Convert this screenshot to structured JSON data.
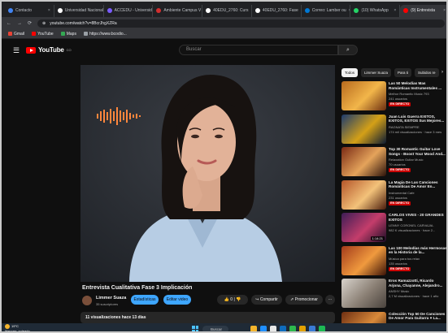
{
  "browser": {
    "tabs": [
      {
        "label": "Contacto",
        "color": "#4285f4",
        "active": false
      },
      {
        "label": "Universidad Nacional",
        "color": "#ffffff",
        "active": false
      },
      {
        "label": "ACCEDU - Universida",
        "color": "#7a5cff",
        "active": false
      },
      {
        "label": "Ambiente Campus V",
        "color": "#d32f2f",
        "active": false
      },
      {
        "label": "40EDU_2760: Curs",
        "color": "#ffffff",
        "active": false
      },
      {
        "label": "40EDU_2760: Fase",
        "color": "#ffffff",
        "active": false
      },
      {
        "label": "Correo: Lamber ou",
        "color": "#0078d4",
        "active": false
      },
      {
        "label": "(10) WhatsApp",
        "color": "#25d366",
        "active": false
      },
      {
        "label": "(9) Entrevista",
        "color": "#ff0000",
        "active": true
      }
    ],
    "url": "youtube.com/watch?v=8BcrJhgXZRa",
    "bookmarks": [
      {
        "label": "Gmail",
        "color": "#ea4335"
      },
      {
        "label": "YouTube",
        "color": "#ff0000"
      },
      {
        "label": "Maps",
        "color": "#34a853"
      },
      {
        "label": "https://www.bcodio...",
        "color": "#9aa0a6"
      }
    ]
  },
  "youtube": {
    "logo_text": "YouTube",
    "country_code": "CO",
    "search_placeholder": "Buscar",
    "video": {
      "title": "Entrevista Cualitativa Fase 3 Implicación",
      "channel": "Limmer Suaza",
      "subscribers": "35 suscriptores",
      "buttons": {
        "analytics": "Estadísticas",
        "edit": "Editar video",
        "likes": "0",
        "share": "Compartir",
        "promote": "Promocionar",
        "more": "···"
      },
      "description_meta": "11 visualizaciones  hace 13 días"
    },
    "chips": [
      {
        "label": "Todos",
        "active": true
      },
      {
        "label": "Limmer Suaza",
        "active": false
      },
      {
        "label": "Para ti",
        "active": false
      },
      {
        "label": "Subidos re",
        "active": false
      }
    ],
    "recommendations": [
      {
        "title": "Las 50 Melodías Mas Románticas Instrumentales ...",
        "channel": "Melhor Romantic Music 793",
        "meta": "241 usuarios",
        "badge": "EN DIRECTO",
        "duration": "",
        "colors": [
          "#b86a1e",
          "#f2b64a",
          "#6b2d10"
        ]
      },
      {
        "title": "Juan Luis Guerra EXITOS, EXITOS, EXITOS Sus Mejores...",
        "channel": "RAGNATA SIEMPRE",
        "meta": "174 mil visualizaciones · hace 3 mes",
        "badge": "",
        "duration": "",
        "colors": [
          "#1c3b6e",
          "#d4a017",
          "#0b1a33"
        ]
      },
      {
        "title": "Top 30 Romantic Guitar Love Songs - Boost Your Mood And...",
        "channel": "Relaxation Guitar Music",
        "meta": "70 usuarios",
        "badge": "EN DIRECTO",
        "duration": "",
        "colors": [
          "#7a2a14",
          "#e4a35b",
          "#2c120a"
        ]
      },
      {
        "title": "La Magia De Las Canciones Románticas De Amor En...",
        "channel": "Instrumental Cafe",
        "meta": "231 usuarios",
        "badge": "EN DIRECTO",
        "duration": "",
        "colors": [
          "#b5562a",
          "#f3c27a",
          "#4a1c0c"
        ]
      },
      {
        "title": "CARLOS VIVES - 20 GRANDES EXITOS",
        "channel": "LENNY CORONEL CARVAJAL",
        "meta": "982 K visualizaciones · hace 2...",
        "badge": "",
        "duration": "1:14:21",
        "colors": [
          "#3d1d56",
          "#c43d6b",
          "#1a0c25"
        ]
      },
      {
        "title": "Las 100 Melodías más Hermosas en la Historia de la...",
        "channel": "Música para tus relax",
        "meta": "135 usuarios",
        "badge": "EN DIRECTO",
        "duration": "",
        "colors": [
          "#a33b1b",
          "#f09a3e",
          "#3b1207"
        ]
      },
      {
        "title": "Eros Ramazzotti, Ricardo Arjona, Chayanne, Alejandro...",
        "channel": "ANSHY Music",
        "meta": "2,7 M visualizaciones · hace 1 año",
        "badge": "",
        "duration": "",
        "colors": [
          "#d8d3cc",
          "#8a7f74",
          "#4a433d"
        ]
      },
      {
        "title": "Colección Top 50 De Canciones De Amor Para Guitarra ♥ La...",
        "channel": "",
        "meta": "",
        "badge": "",
        "duration": "",
        "colors": [
          "#6e2f12",
          "#d98a3a",
          "#2b0f05"
        ]
      }
    ]
  },
  "taskbar": {
    "temperature": "19°C",
    "weather": "Mayorm. soleado",
    "search_label": "Buscar",
    "app_colors": [
      "#f5b52c",
      "#1f8fff",
      "#e8e8e8",
      "#0f6cbd",
      "#2db84d",
      "#e2a100",
      "#3a7bd5",
      "#1db954"
    ]
  }
}
